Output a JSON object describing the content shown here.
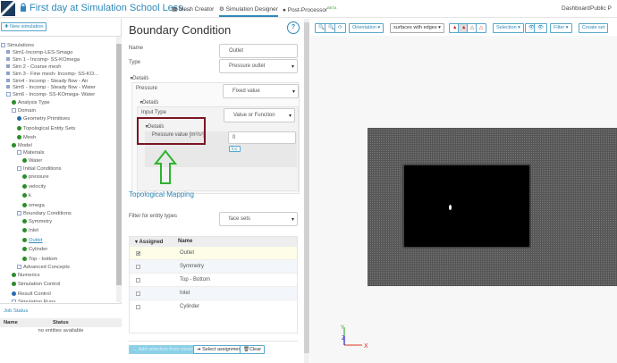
{
  "header": {
    "title": "First day at Simulation School Less...",
    "nav": [
      {
        "label": "Mesh Creator"
      },
      {
        "label": "Simulation Designer"
      },
      {
        "label": "Post-Processor",
        "badge": "BETA"
      }
    ],
    "right": [
      "Dashboard",
      "Public P"
    ]
  },
  "left": {
    "new_simulation": "New simulation",
    "tree": [
      {
        "label": "Simulations",
        "icon": "minus",
        "lvl": 0
      },
      {
        "label": "Sim1-Incomp-LES-Smago",
        "icon": "sq",
        "lvl": 1
      },
      {
        "label": "Sim 1 - Incomp- SS-KOmega",
        "icon": "sq",
        "lvl": 1
      },
      {
        "label": "Sim 2 - Coarse mesh",
        "icon": "sq",
        "lvl": 1
      },
      {
        "label": "Sim 3 - Fine mesh- Incomp- SS-KO...",
        "icon": "sq",
        "lvl": 1
      },
      {
        "label": "Sim4 - Incomp - Steady flow - Air",
        "icon": "sq",
        "lvl": 1
      },
      {
        "label": "Sim5 - Incomp - Steady flow - Water",
        "icon": "sq",
        "lvl": 1
      },
      {
        "label": "Sim6 - Incomp- SS-KOmega- Water",
        "icon": "minus",
        "lvl": 1
      },
      {
        "label": "Analysis Type",
        "icon": "ok",
        "lvl": 2
      },
      {
        "label": "Domain",
        "icon": "minus",
        "lvl": 2
      },
      {
        "label": "Geometry Primitives",
        "icon": "bl",
        "lvl": 3
      },
      {
        "label": "Topological Entity Sets",
        "icon": "ok",
        "lvl": 3
      },
      {
        "label": "Mesh",
        "icon": "ok",
        "lvl": 3
      },
      {
        "label": "Model",
        "icon": "ok",
        "lvl": 2
      },
      {
        "label": "Materials",
        "icon": "minus",
        "lvl": 3
      },
      {
        "label": "Water",
        "icon": "ok",
        "lvl": 4
      },
      {
        "label": "Initial Conditions",
        "icon": "minus",
        "lvl": 3
      },
      {
        "label": "pressure",
        "icon": "ok",
        "lvl": 4
      },
      {
        "label": "velocity",
        "icon": "ok",
        "lvl": 4
      },
      {
        "label": "k",
        "icon": "ok",
        "lvl": 4
      },
      {
        "label": "omega",
        "icon": "ok",
        "lvl": 4
      },
      {
        "label": "Boundary Conditions",
        "icon": "minus",
        "lvl": 3
      },
      {
        "label": "Symmetry",
        "icon": "ok",
        "lvl": 4
      },
      {
        "label": "Inlet",
        "icon": "ok",
        "lvl": 4
      },
      {
        "label": "Outlet",
        "icon": "ok",
        "lvl": 4,
        "active": true
      },
      {
        "label": "Cylinder",
        "icon": "ok",
        "lvl": 4
      },
      {
        "label": "Top - bottom",
        "icon": "ok",
        "lvl": 4
      },
      {
        "label": "Advanced Concepts",
        "icon": "minus",
        "lvl": 3
      },
      {
        "label": "Numerics",
        "icon": "ok",
        "lvl": 2
      },
      {
        "label": "Simulation Control",
        "icon": "ok",
        "lvl": 2
      },
      {
        "label": "Result Control",
        "icon": "bl",
        "lvl": 2
      },
      {
        "label": "Simulation Runs",
        "icon": "minus",
        "lvl": 2
      }
    ],
    "job_status": {
      "title": "Job Status",
      "cols": [
        "Name",
        "Status"
      ],
      "empty": "no entities available"
    }
  },
  "bc": {
    "title": "Boundary Condition",
    "help": "?",
    "name_label": "Name",
    "name_value": "Outlet",
    "type_label": "Type",
    "type_value": "Pressure outlet",
    "details": "Details",
    "pressure_label": "Pressure",
    "pressure_value": "Fixed value",
    "input_type_label": "Input Type",
    "input_type_value": "Value or Function",
    "pv_label": "Pressure value [m²/s²]",
    "pv_value": "0",
    "fx": "f(x)"
  },
  "mapping": {
    "title": "Topological Mapping",
    "filter_label": "Filter for entity types",
    "filter_value": "face sets",
    "cols": [
      "Assigned",
      "Name"
    ],
    "rows": [
      {
        "name": "Outlet",
        "checked": true
      },
      {
        "name": "Symmetry",
        "checked": false
      },
      {
        "name": "Top - Bottom",
        "checked": false
      },
      {
        "name": "Inlet",
        "checked": false
      },
      {
        "name": "Cylinder",
        "checked": false
      }
    ],
    "add": "Add selection from viewer",
    "select": "Select assignment",
    "clear": "Clear"
  },
  "viewer": {
    "orientation": "Orientation",
    "render_mode": "surfaces with edges",
    "selection": "Selection",
    "filter": "Filter",
    "create_set": "Create set",
    "axes": {
      "x": "X",
      "y": "Y",
      "z": "Z"
    }
  }
}
